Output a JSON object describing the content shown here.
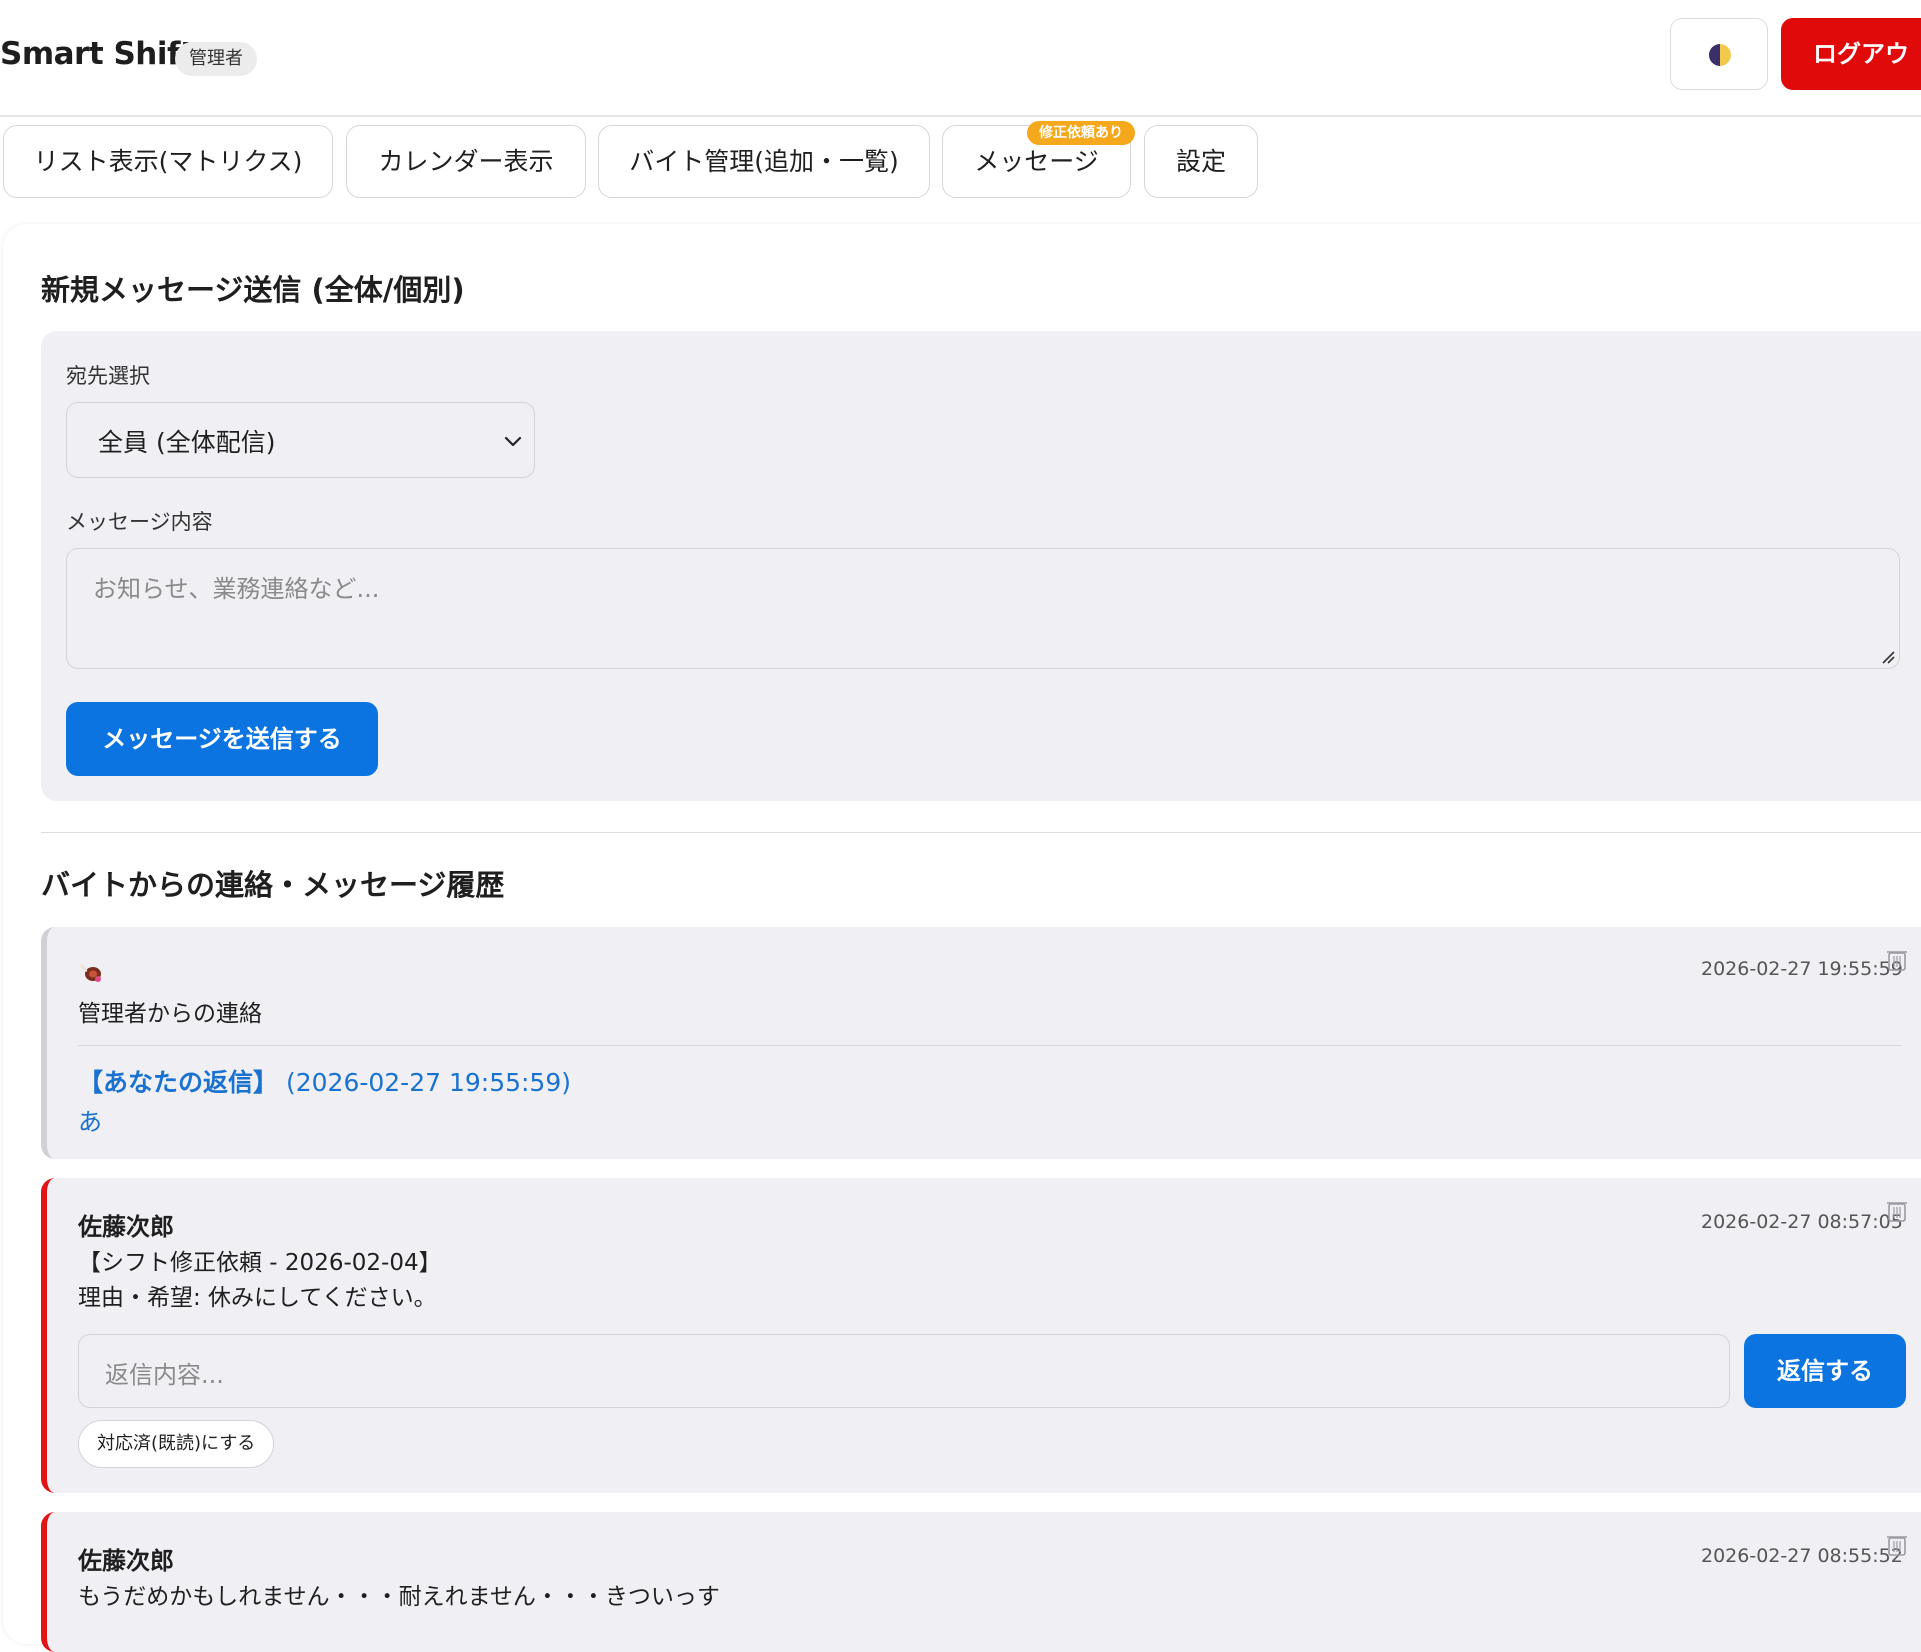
{
  "header": {
    "brand": "Smart Shift",
    "role": "管理者",
    "theme_icon": "theme-toggle-icon",
    "logout_label": "ログアウ"
  },
  "tabs": [
    {
      "label": "リスト表示(マトリクス)"
    },
    {
      "label": "カレンダー表示"
    },
    {
      "label": "バイト管理(追加・一覧)"
    },
    {
      "label": "メッセージ"
    },
    {
      "label": "設定"
    }
  ],
  "tab_badge": "修正依頼あり",
  "compose": {
    "title": "新規メッセージ送信 (全体/個別)",
    "recipient_label": "宛先選択",
    "recipient_value": "全員 (全体配信)",
    "content_label": "メッセージ内容",
    "content_placeholder": "お知らせ、業務連絡など...",
    "send_label": "メッセージを送信する"
  },
  "history": {
    "title": "バイトからの連絡・メッセージ履歴",
    "messages": [
      {
        "sender_icon": "meat-icon",
        "timestamp": "2026-02-27 19:55:59",
        "body": "管理者からの連絡",
        "reply_head_label": "【あなたの返信】",
        "reply_time": "(2026-02-27 19:55:59)",
        "reply_text": "あ"
      },
      {
        "sender": "佐藤次郎",
        "timestamp": "2026-02-27 08:57:05",
        "body_line1": "【シフト修正依頼 - 2026-02-04】",
        "body_line2": "理由・希望: 休みにしてください。",
        "reply_placeholder": "返信内容...",
        "reply_button": "返信する",
        "mark_done": "対応済(既読)にする"
      },
      {
        "sender": "佐藤次郎",
        "timestamp": "2026-02-27 08:55:52",
        "body": "もうだめかもしれません・・・耐えれません・・・きついっす"
      }
    ]
  },
  "colors": {
    "primary": "#0b74e0",
    "danger": "#e10a0a",
    "badge": "#f5a81c",
    "panel": "#f0eff4"
  }
}
